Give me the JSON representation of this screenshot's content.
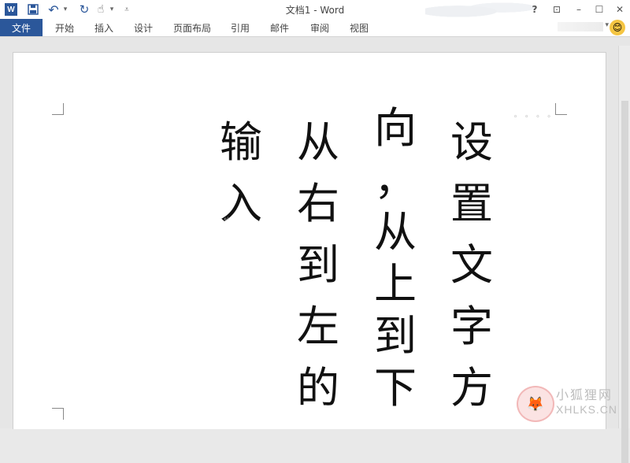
{
  "window": {
    "title": "文档1 - Word",
    "help_label": "?",
    "ribbon_display_label": "⊡",
    "minimize_label": "–",
    "maximize_label": "☐",
    "close_label": "✕"
  },
  "quick_access": {
    "logo_label": "W",
    "save_label": "💾",
    "undo_label": "↶",
    "undo_dropdown_label": "▾",
    "redo_label": "↻",
    "touch_label": "☝",
    "touch_dropdown_label": "▾",
    "customize_label": "⩡"
  },
  "ribbon": {
    "tabs": [
      {
        "label": "文件"
      },
      {
        "label": "开始"
      },
      {
        "label": "插入"
      },
      {
        "label": "设计"
      },
      {
        "label": "页面布局"
      },
      {
        "label": "引用"
      },
      {
        "label": "邮件"
      },
      {
        "label": "审阅"
      },
      {
        "label": "视图"
      }
    ],
    "account_caret": "▾",
    "avatar_label": "😊"
  },
  "document": {
    "columns": [
      [
        "设",
        "置",
        "文",
        "字",
        "方"
      ],
      [
        "向",
        "，",
        "从",
        "上",
        "到",
        "下",
        "，"
      ],
      [
        "从",
        "右",
        "到",
        "左",
        "的"
      ],
      [
        "输",
        "入"
      ]
    ],
    "paragraph_mark": "↵",
    "dots": "◦ ◦ ◦ ◦"
  },
  "watermark": {
    "cn": "小狐狸网",
    "en": "XHLKS.CN"
  },
  "colors": {
    "accent": "#2b579a",
    "text": "#111111",
    "page": "#ffffff"
  }
}
